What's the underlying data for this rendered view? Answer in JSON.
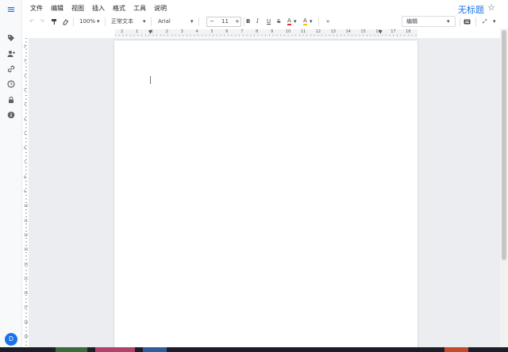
{
  "menu": [
    "文件",
    "编辑",
    "视图",
    "插入",
    "格式",
    "工具",
    "说明"
  ],
  "doc_title": "无标题",
  "toolbar": {
    "zoom": "100%",
    "style": "正常文本",
    "font": "Arial",
    "font_size": "11",
    "minus": "−",
    "plus": "+",
    "bold": "B",
    "italic": "I",
    "underline": "U",
    "strike": "S",
    "text_color": "A",
    "highlight": "A",
    "more": "»",
    "mode": "编辑"
  },
  "ruler_numbers": [
    "2",
    "1",
    "1",
    "2",
    "3",
    "4",
    "5",
    "6",
    "7",
    "8",
    "9",
    "10",
    "11",
    "12",
    "13",
    "14",
    "15",
    "16",
    "17",
    "18"
  ],
  "vruler_numbers": [
    "2",
    "1",
    "1",
    "2",
    "3",
    "4",
    "5",
    "6",
    "7",
    "8",
    "9",
    "10",
    "11",
    "12",
    "13",
    "14",
    "15",
    "16",
    "17",
    "18",
    "19",
    "20"
  ],
  "avatar_initial": "D",
  "colors": {
    "accent": "#1a73e8",
    "canvas": "#ebedf0",
    "highlight_bar": "#fbbc04",
    "text_color_bar": "#d93025"
  }
}
